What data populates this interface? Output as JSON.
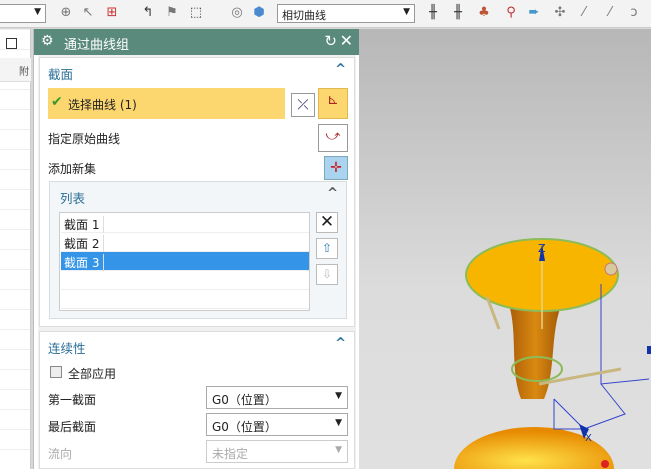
{
  "toolbar": {
    "curve_rule": "相切曲线",
    "left_select": ""
  },
  "left_panel": {
    "header_text": "附"
  },
  "dialog": {
    "title": "通过曲线组",
    "section": {
      "title": "截面",
      "select_curve": "选择曲线 (1)",
      "specify_origin": "指定原始曲线",
      "add_new_set": "添加新集",
      "list": {
        "title": "列表",
        "items": [
          "截面 1",
          "截面 2",
          "截面 3"
        ],
        "selected_index": 2
      }
    },
    "continuity": {
      "title": "连续性",
      "apply_all": "全部应用",
      "apply_all_checked": false,
      "first_section_label": "第一截面",
      "first_section_value": "G0（位置）",
      "last_section_label": "最后截面",
      "last_section_value": "G0（位置）",
      "flow_label": "流向",
      "flow_value": "未指定"
    }
  },
  "viewport": {
    "axis_z": "Z",
    "axis_x": "X"
  },
  "colors": {
    "title_bar": "#5a8a7c",
    "highlight": "#fcd770",
    "selection": "#3394e8",
    "model": "#f7b500"
  }
}
